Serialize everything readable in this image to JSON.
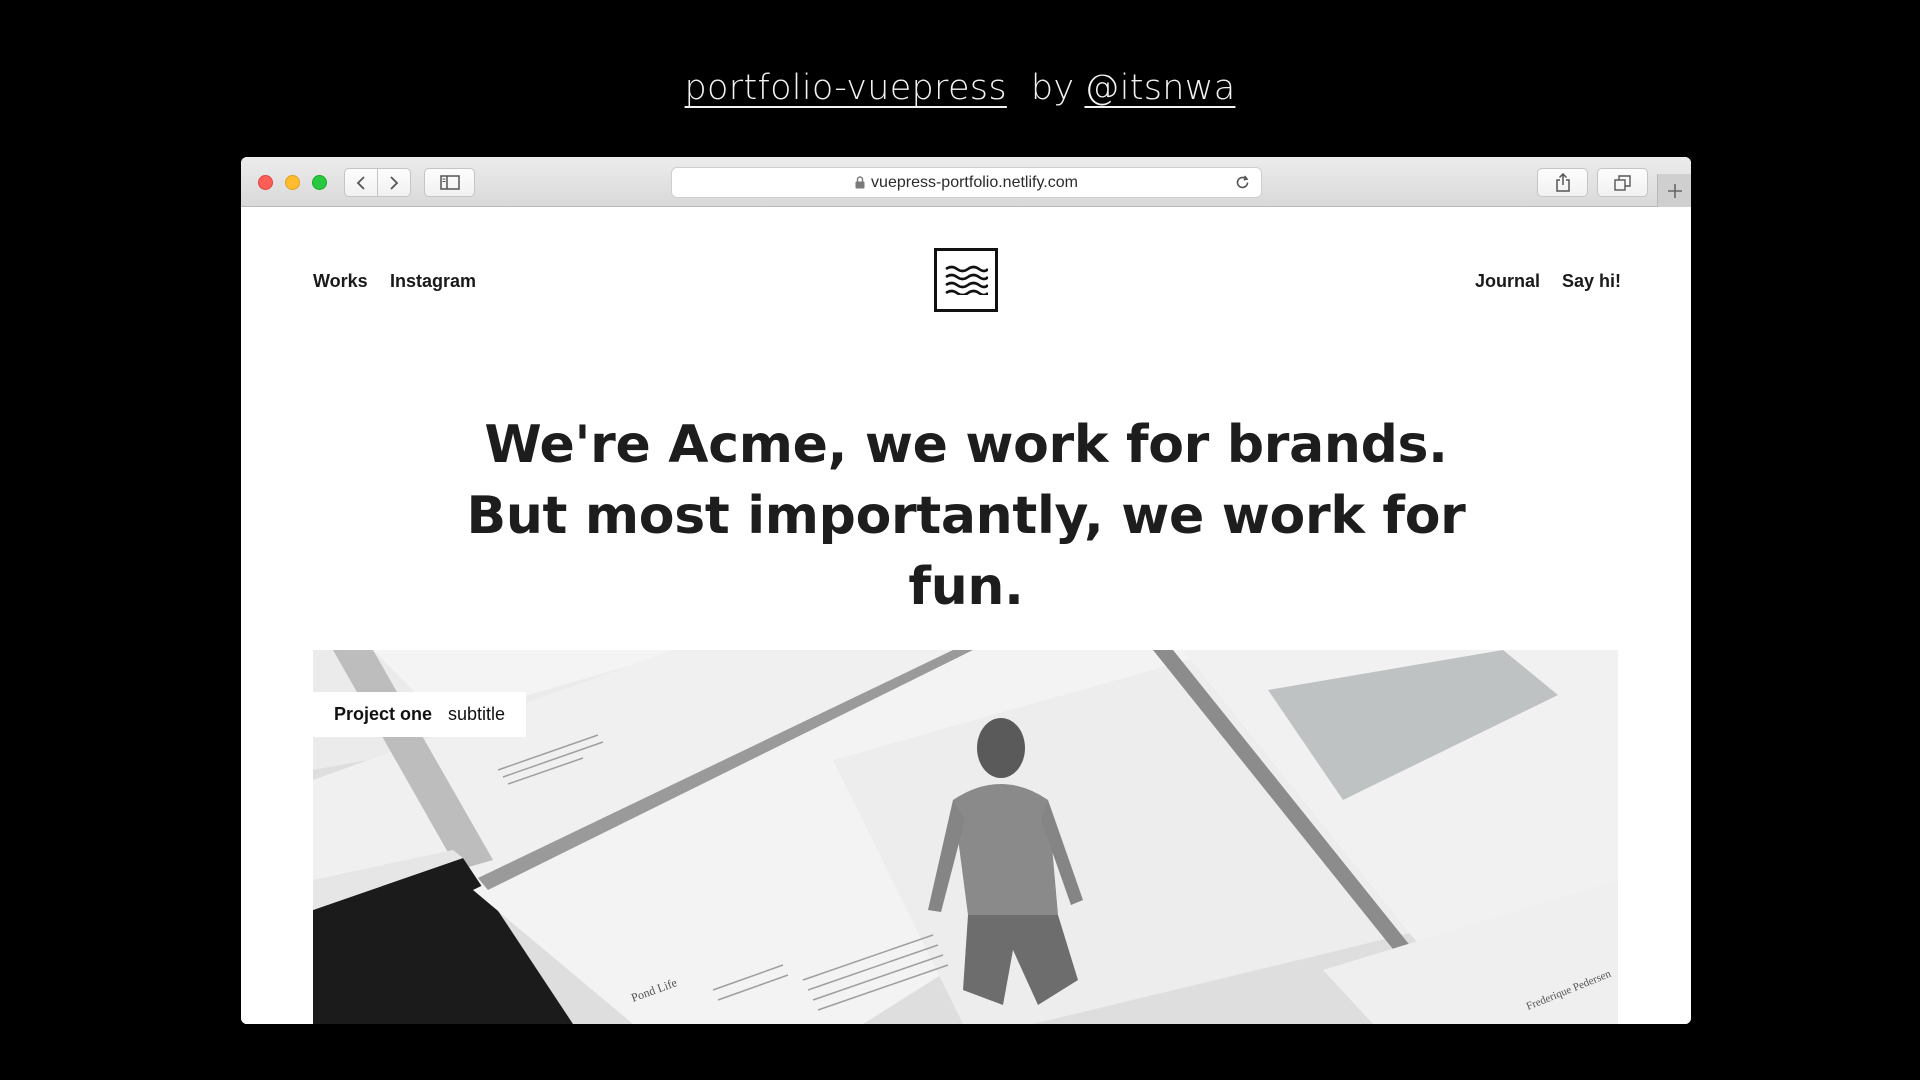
{
  "caption": {
    "repo": "portfolio-vuepress",
    "by": "by",
    "author": "@itsnwa"
  },
  "browser": {
    "url": "vuepress-portfolio.netlify.com"
  },
  "site": {
    "nav_left": [
      "Works",
      "Instagram"
    ],
    "nav_right": [
      "Journal",
      "Say hi!"
    ],
    "hero_bold": "We're Acme",
    "hero_rest": ", we work for brands. But most importantly, we work for fun.",
    "project": {
      "title": "Project one",
      "subtitle": "subtitle",
      "image_text": {
        "spread_title": "Pond Life",
        "spread_right": "Frederique Pedersen"
      }
    }
  }
}
